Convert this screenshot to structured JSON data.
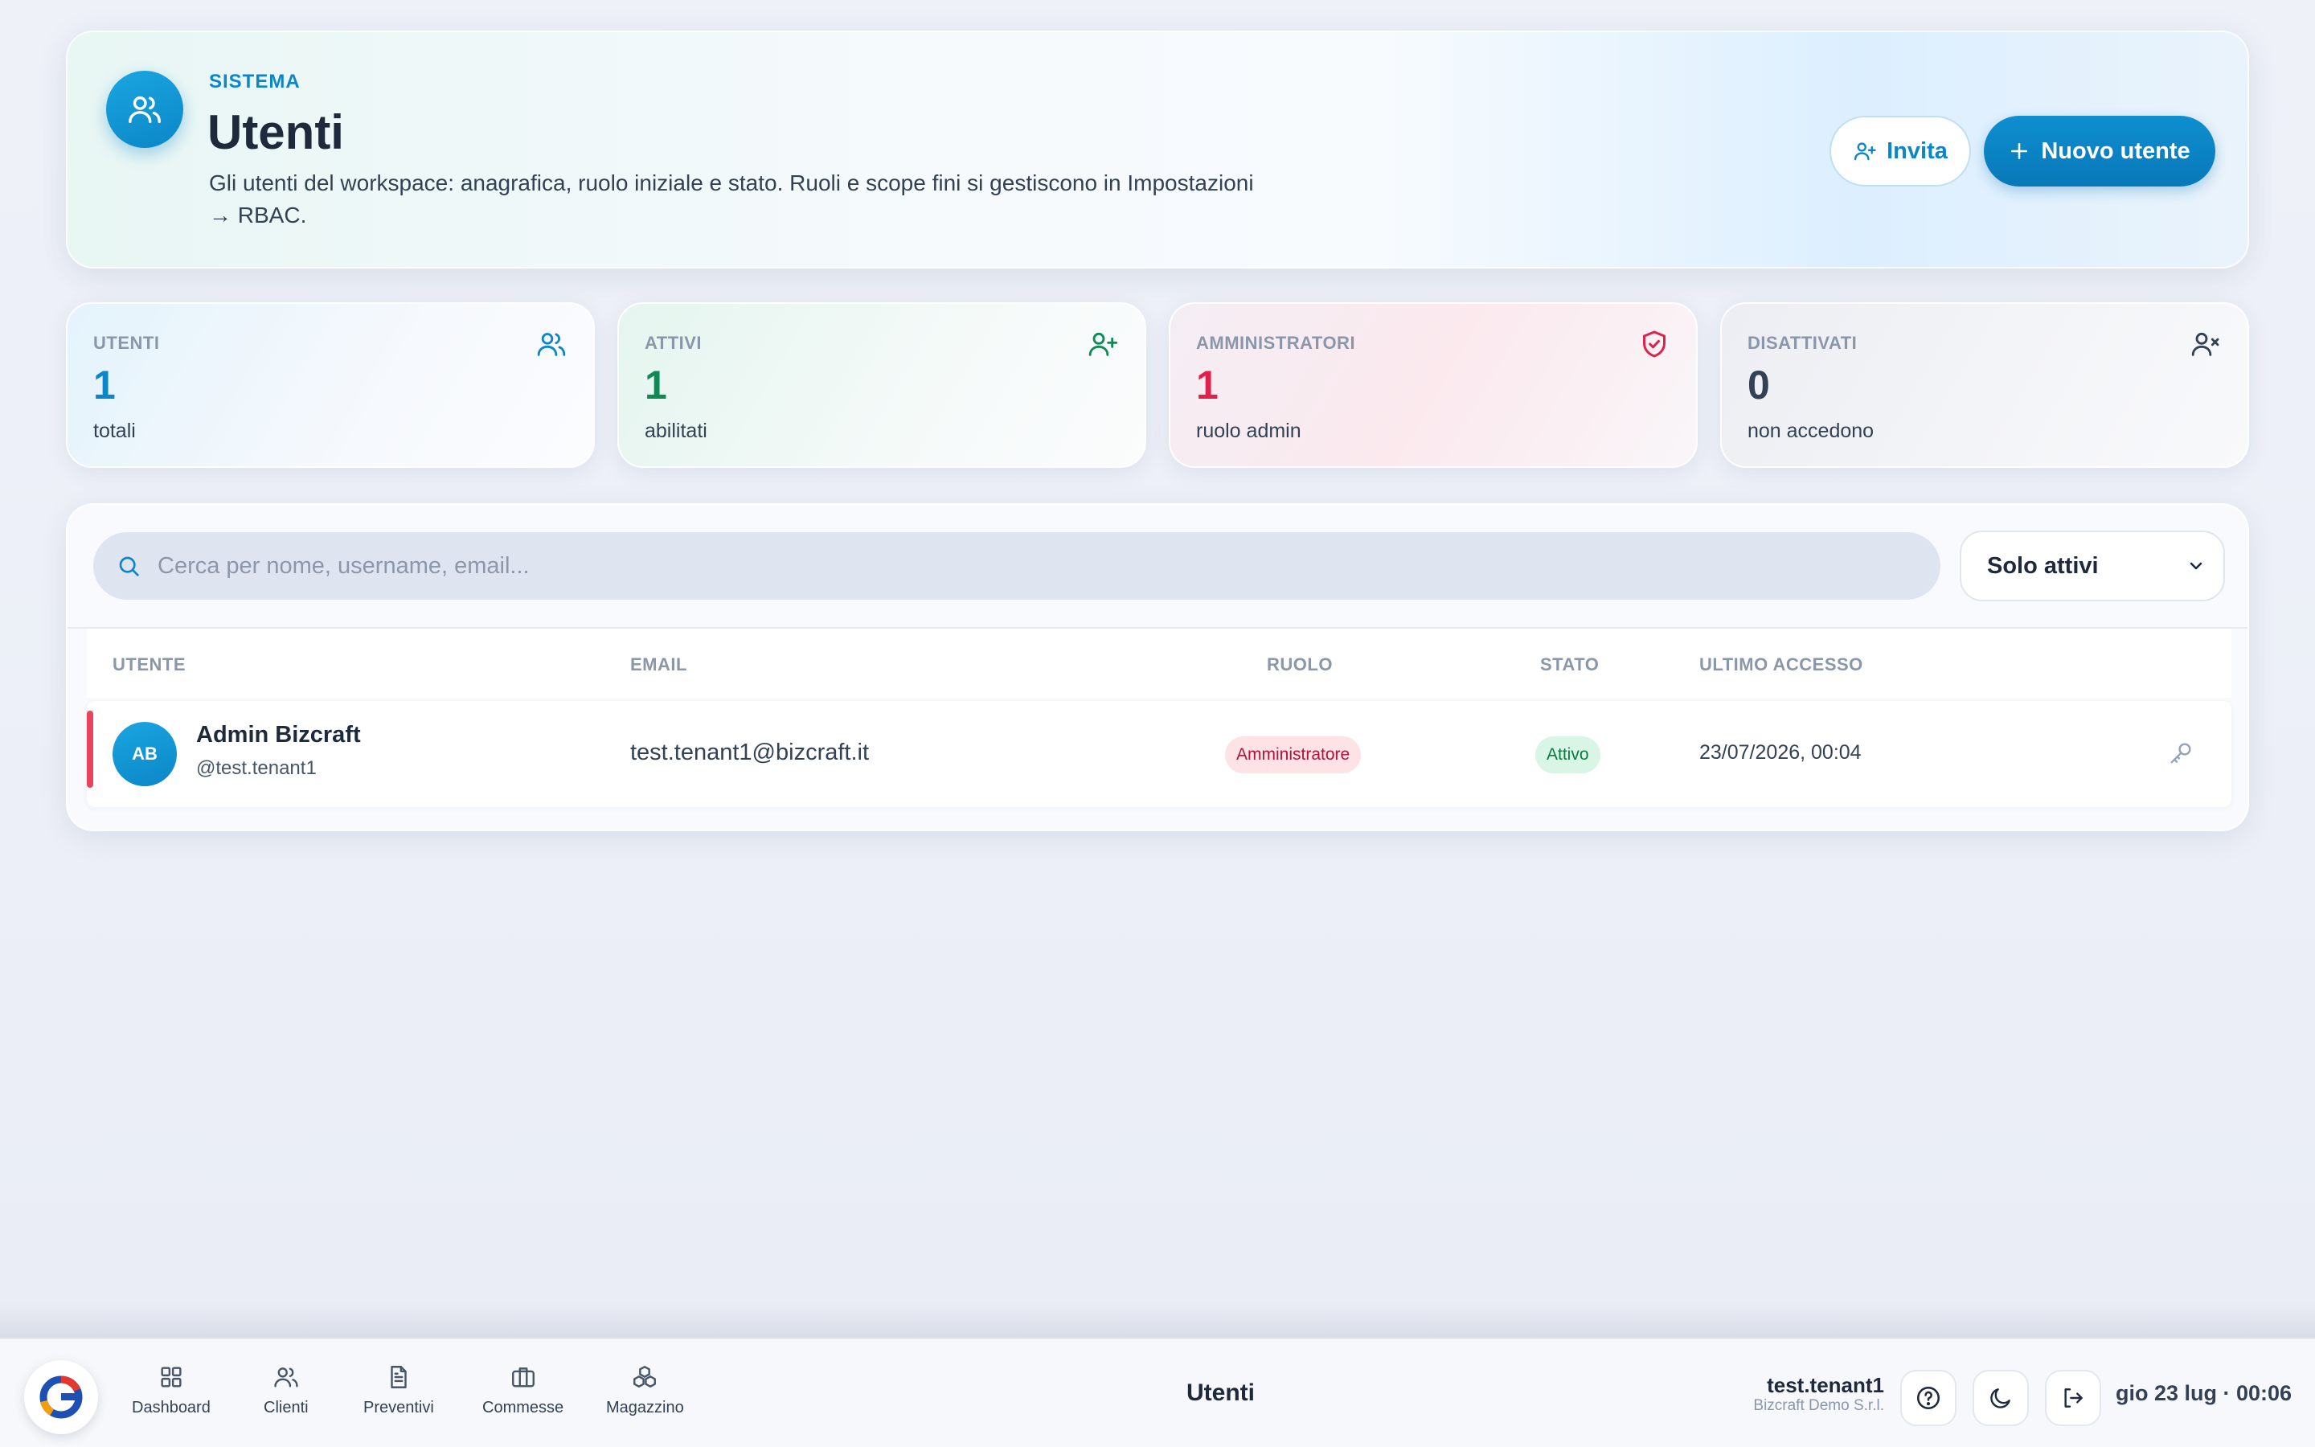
{
  "header": {
    "eyebrow": "SISTEMA",
    "title": "Utenti",
    "description": "Gli utenti del workspace: anagrafica, ruolo iniziale e stato. Ruoli e scope fini si gestiscono in Impostazioni → RBAC.",
    "invite_label": "Invita",
    "new_user_label": "Nuovo utente",
    "icon": "users-icon"
  },
  "stats": [
    {
      "label": "UTENTI",
      "value": "1",
      "sub": "totali",
      "icon": "users-icon",
      "color": "#0b86c8"
    },
    {
      "label": "ATTIVI",
      "value": "1",
      "sub": "abilitati",
      "icon": "user-plus-icon",
      "color": "#0f8a55"
    },
    {
      "label": "AMMINISTRATORI",
      "value": "1",
      "sub": "ruolo admin",
      "icon": "shield-check-icon",
      "color": "#e0214b"
    },
    {
      "label": "DISATTIVATI",
      "value": "0",
      "sub": "non accedono",
      "icon": "user-x-icon",
      "color": "#334155"
    }
  ],
  "search": {
    "placeholder": "Cerca per nome, username, email...",
    "value": ""
  },
  "filter": {
    "selected": "Solo attivi"
  },
  "table": {
    "columns": [
      "UTENTE",
      "EMAIL",
      "RUOLO",
      "STATO",
      "ULTIMO ACCESSO"
    ],
    "rows": [
      {
        "initials": "AB",
        "name": "Admin Bizcraft",
        "username": "@test.tenant1",
        "email": "test.tenant1@bizcraft.it",
        "role": "Amministratore",
        "status": "Attivo",
        "last_access": "23/07/2026, 00:04",
        "action_icon": "key-icon"
      }
    ]
  },
  "bottombar": {
    "nav": [
      {
        "label": "Dashboard",
        "icon": "dashboard-icon"
      },
      {
        "label": "Clienti",
        "icon": "users-icon"
      },
      {
        "label": "Preventivi",
        "icon": "document-icon"
      },
      {
        "label": "Commesse",
        "icon": "briefcase-icon"
      },
      {
        "label": "Magazzino",
        "icon": "boxes-icon"
      }
    ],
    "current_page": "Utenti",
    "user_name": "test.tenant1",
    "org_name": "Bizcraft Demo S.r.l.",
    "datetime": "gio 23 lug · 00:06"
  },
  "colors": {
    "accent": "#0b86c8",
    "danger": "#e9435f",
    "success": "#0f7a43"
  }
}
